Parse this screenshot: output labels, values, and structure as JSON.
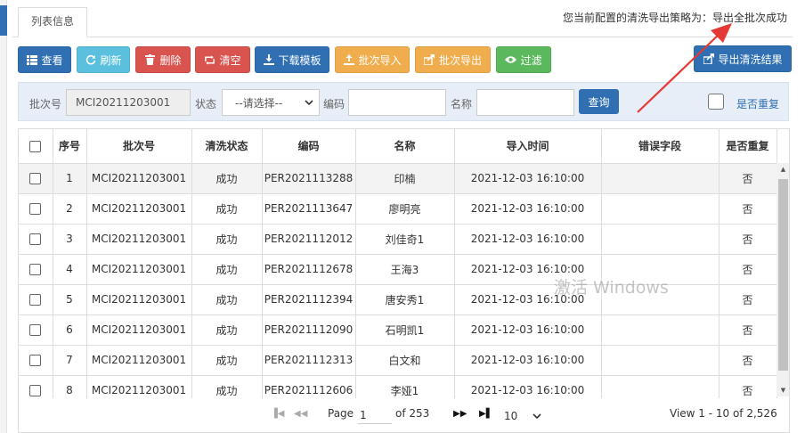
{
  "tab": {
    "label": "列表信息"
  },
  "strategy_text": "您当前配置的清洗导出策略为：导出全批次成功",
  "toolbar": {
    "view": "查看",
    "refresh": "刷新",
    "delete": "删除",
    "clear": "清空",
    "download_template": "下载模板",
    "batch_import": "批次导入",
    "batch_export": "批次导出",
    "filter": "过滤"
  },
  "export_clean": "导出清洗结果",
  "search": {
    "batch_label": "批次号",
    "batch_value": "MCI20211203001",
    "status_label": "状态",
    "status_value": "--请选择--",
    "code_label": "编码",
    "code_value": "",
    "name_label": "名称",
    "name_value": "",
    "query": "查询",
    "dup_label": "是否重复"
  },
  "table": {
    "headers": [
      "序号",
      "批次号",
      "清洗状态",
      "编码",
      "名称",
      "导入时间",
      "错误字段",
      "是否重复"
    ],
    "rows": [
      [
        "1",
        "MCI20211203001",
        "成功",
        "PER2021113288",
        "印楠",
        "2021-12-03 16:10:00",
        "",
        "否"
      ],
      [
        "2",
        "MCI20211203001",
        "成功",
        "PER2021113647",
        "廖明亮",
        "2021-12-03 16:10:00",
        "",
        "否"
      ],
      [
        "3",
        "MCI20211203001",
        "成功",
        "PER2021112012",
        "刘佳奇1",
        "2021-12-03 16:10:00",
        "",
        "否"
      ],
      [
        "4",
        "MCI20211203001",
        "成功",
        "PER2021112678",
        "王海3",
        "2021-12-03 16:10:00",
        "",
        "否"
      ],
      [
        "5",
        "MCI20211203001",
        "成功",
        "PER2021112394",
        "唐安秀1",
        "2021-12-03 16:10:00",
        "",
        "否"
      ],
      [
        "6",
        "MCI20211203001",
        "成功",
        "PER2021112090",
        "石明凯1",
        "2021-12-03 16:10:00",
        "",
        "否"
      ],
      [
        "7",
        "MCI20211203001",
        "成功",
        "PER2021112313",
        "白文和",
        "2021-12-03 16:10:00",
        "",
        "否"
      ],
      [
        "8",
        "MCI20211203001",
        "成功",
        "PER2021112606",
        "李娅1",
        "2021-12-03 16:10:00",
        "",
        "否"
      ]
    ]
  },
  "pager": {
    "page_label": "Page",
    "page_value": "1",
    "of_label": "of 253",
    "page_size": "10",
    "view_text": "View 1 - 10 of 2,526"
  },
  "watermark": "激活 Windows",
  "colors": {
    "primary": "#2f6fb2",
    "info": "#5bc0de",
    "danger": "#d9534f",
    "warning": "#f0ad4e",
    "success": "#5cb85c",
    "arrow": "#e53935"
  }
}
